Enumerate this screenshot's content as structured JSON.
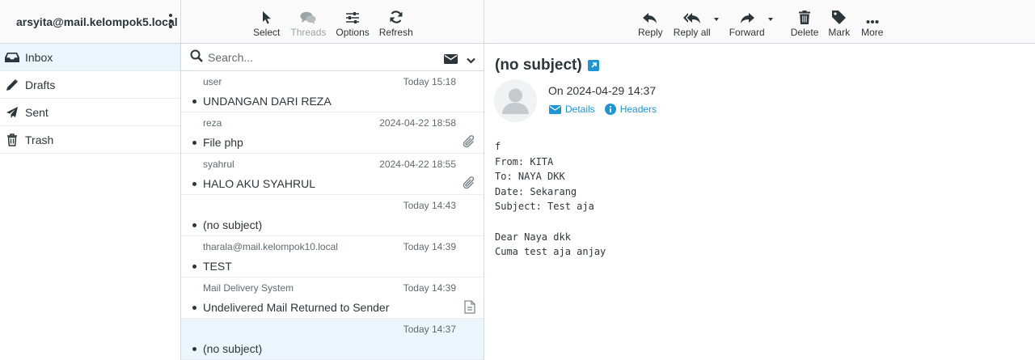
{
  "account": {
    "email": "arsyita@mail.kelompok5.local"
  },
  "folders": [
    {
      "label": "Inbox",
      "icon": "inbox-icon",
      "active": true
    },
    {
      "label": "Drafts",
      "icon": "pencil-icon",
      "active": false
    },
    {
      "label": "Sent",
      "icon": "paper-plane-icon",
      "active": false
    },
    {
      "label": "Trash",
      "icon": "trash-icon",
      "active": false
    }
  ],
  "list_toolbar": {
    "select": "Select",
    "threads": "Threads",
    "options": "Options",
    "refresh": "Refresh"
  },
  "search": {
    "placeholder": "Search..."
  },
  "messages": [
    {
      "from": "user",
      "date": "Today 15:18",
      "subject": "UNDANGAN DARI REZA",
      "attachment": ""
    },
    {
      "from": "reza",
      "date": "2024-04-22 18:58",
      "subject": "File php",
      "attachment": "paperclip"
    },
    {
      "from": "syahrul",
      "date": "2024-04-22 18:55",
      "subject": "HALO AKU SYAHRUL",
      "attachment": "paperclip"
    },
    {
      "from": "",
      "date": "Today 14:43",
      "subject": "(no subject)",
      "attachment": ""
    },
    {
      "from": "tharala@mail.kelompok10.local",
      "date": "Today 14:39",
      "subject": "TEST",
      "attachment": ""
    },
    {
      "from": "Mail Delivery System",
      "date": "Today 14:39",
      "subject": "Undelivered Mail Returned to Sender",
      "attachment": "document"
    },
    {
      "from": "",
      "date": "Today 14:37",
      "subject": "(no subject)",
      "attachment": "",
      "selected": true
    }
  ],
  "message_toolbar": {
    "reply": "Reply",
    "reply_all": "Reply all",
    "forward": "Forward",
    "delete": "Delete",
    "mark": "Mark",
    "more": "More"
  },
  "preview": {
    "subject": "(no subject)",
    "date": "On 2024-04-29 14:37",
    "details": "Details",
    "headers": "Headers",
    "body": "f\nFrom: KITA\nTo: NAYA DKK\nDate: Sekarang\nSubject: Test aja\n\nDear Naya dkk\nCuma test aja anjay"
  },
  "colors": {
    "accent": "#2095d6",
    "selected_bg": "#ebf6fc",
    "text": "#2c363a"
  }
}
